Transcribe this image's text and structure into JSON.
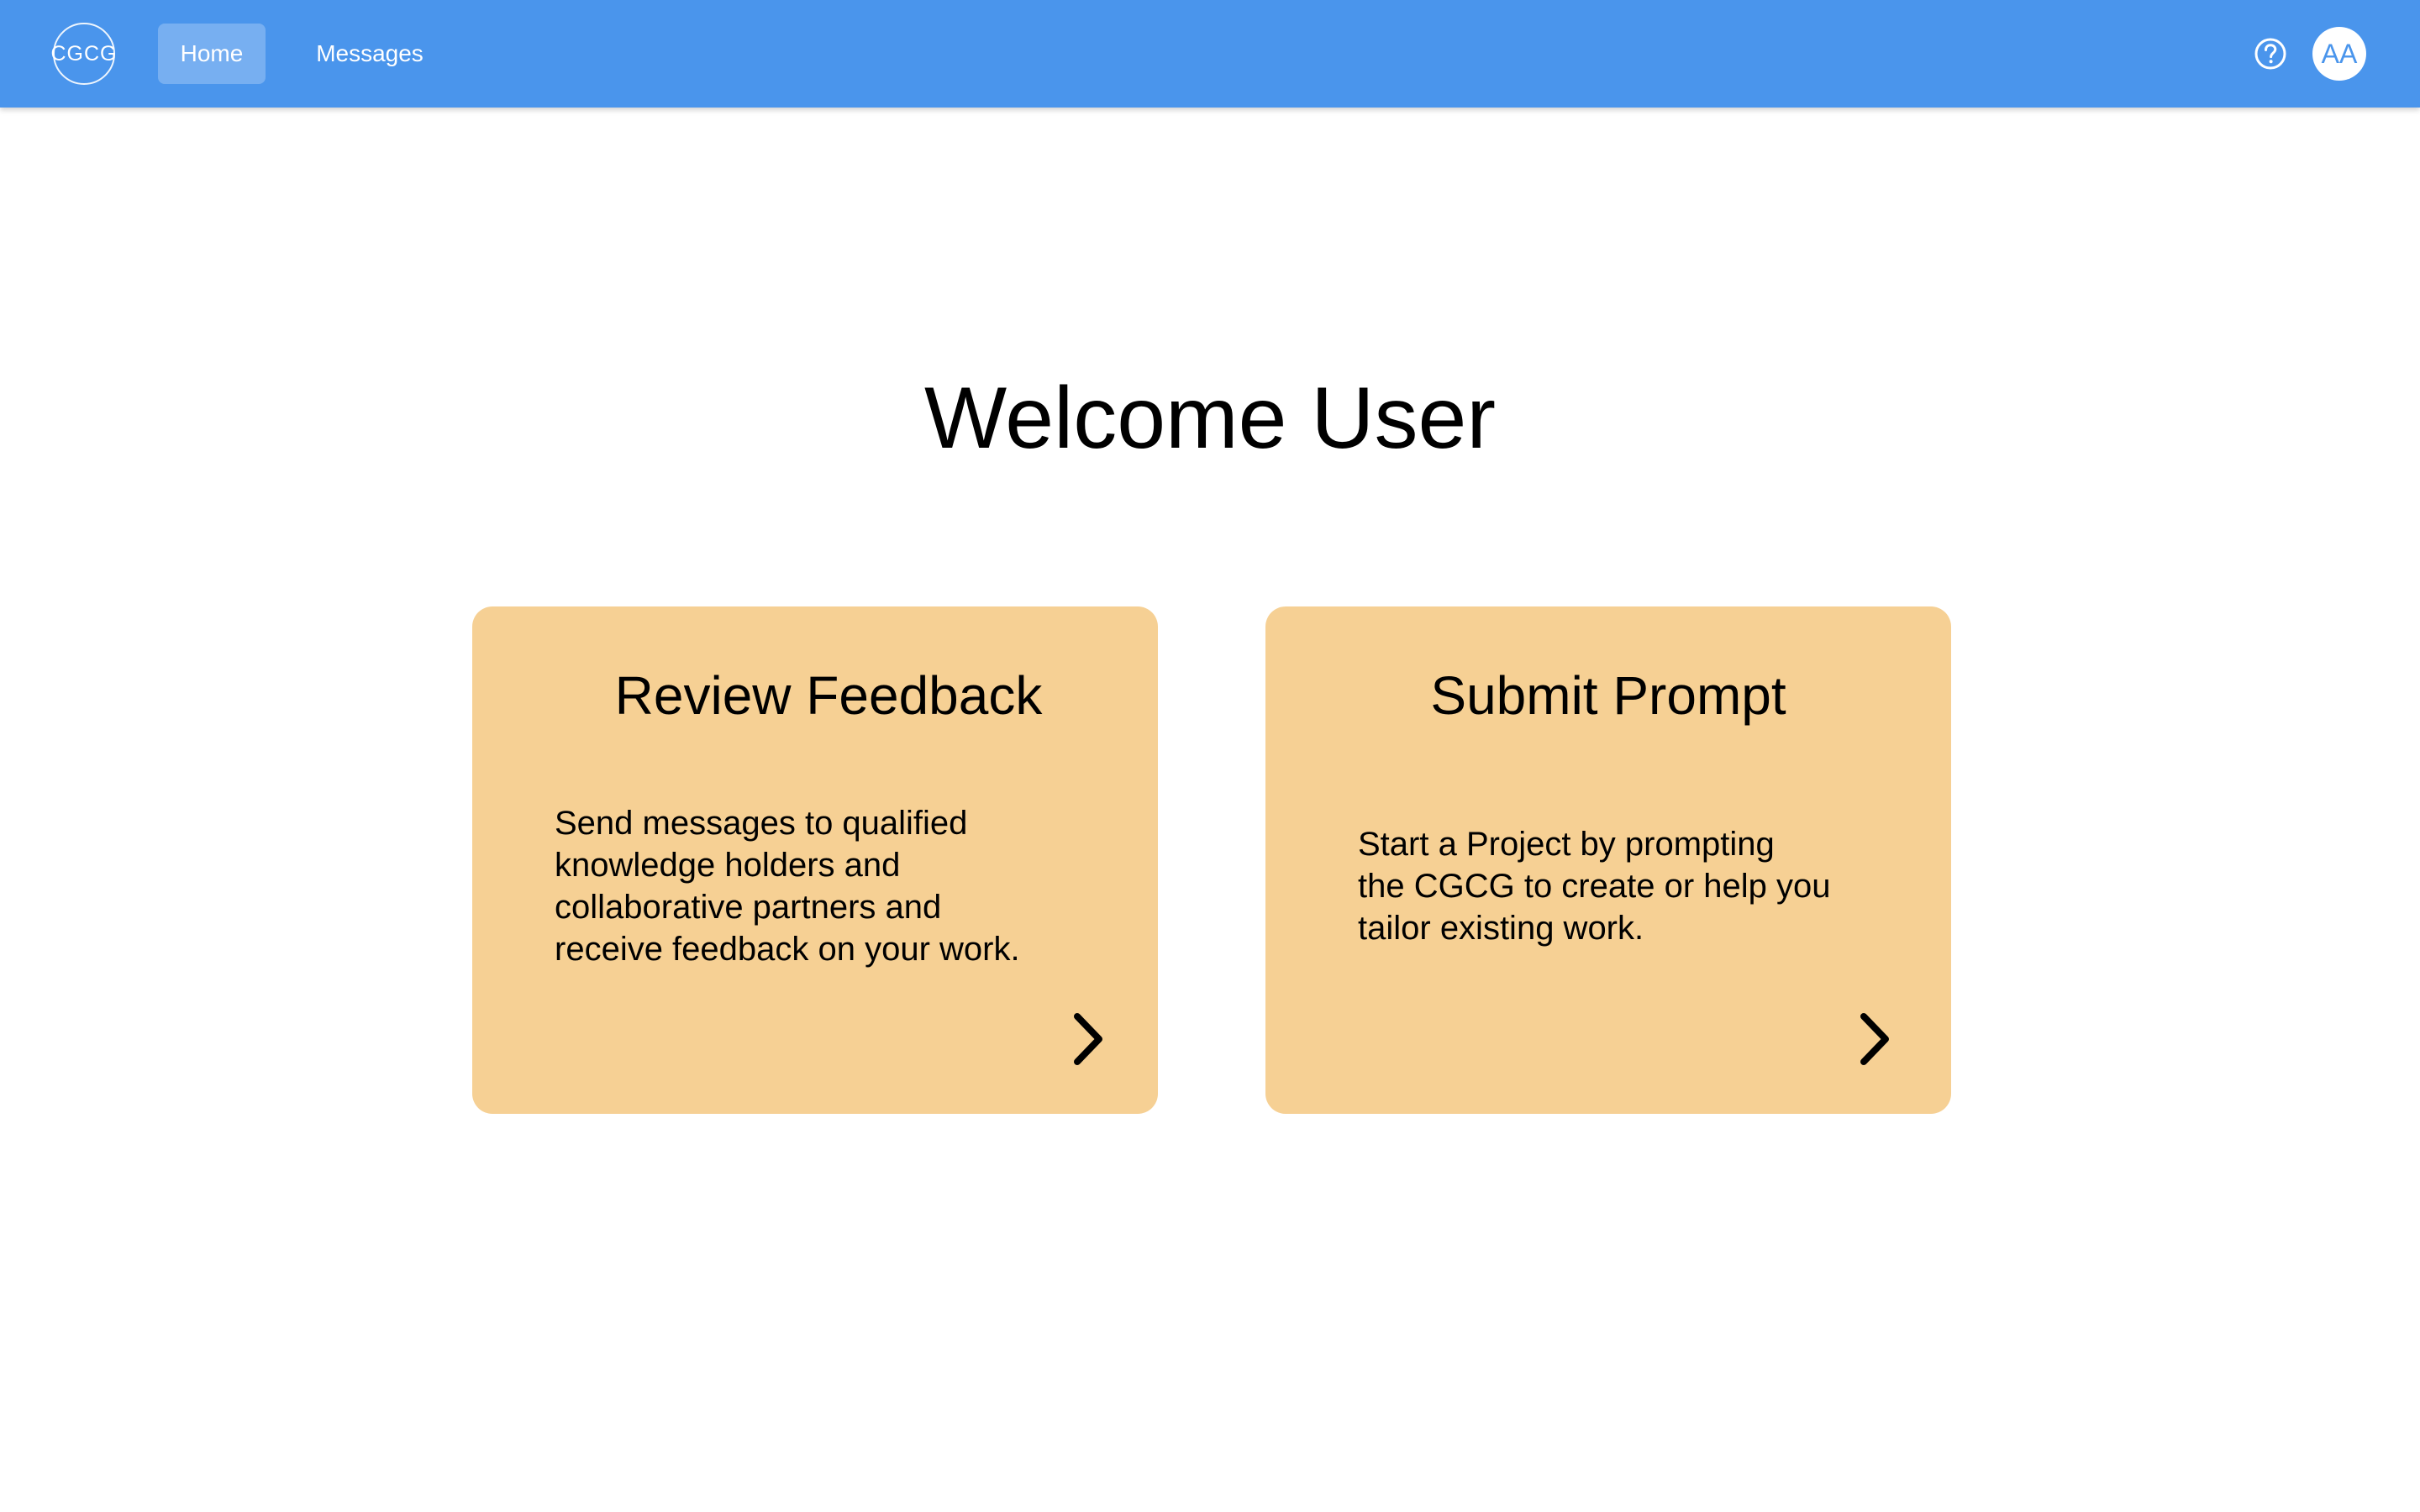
{
  "header": {
    "logo_text": "CGCG",
    "nav": {
      "home_label": "Home",
      "messages_label": "Messages"
    },
    "help_icon": "question-circle-icon",
    "avatar_initials": "AA",
    "colors": {
      "bar": "#4a95ec",
      "text": "#ffffff"
    }
  },
  "main": {
    "title": "Welcome User",
    "cards": [
      {
        "title": "Review Feedback",
        "description": "Send messages to qualified\nknowledge holders and\ncollaborative partners and\nreceive feedback on your work.",
        "icon": "chevron-right-icon"
      },
      {
        "title": "Submit Prompt",
        "description": "Start a Project by prompting\nthe CGCG to create or help you\ntailor existing work.",
        "icon": "chevron-right-icon"
      }
    ],
    "colors": {
      "card_bg": "#f6d094"
    }
  }
}
